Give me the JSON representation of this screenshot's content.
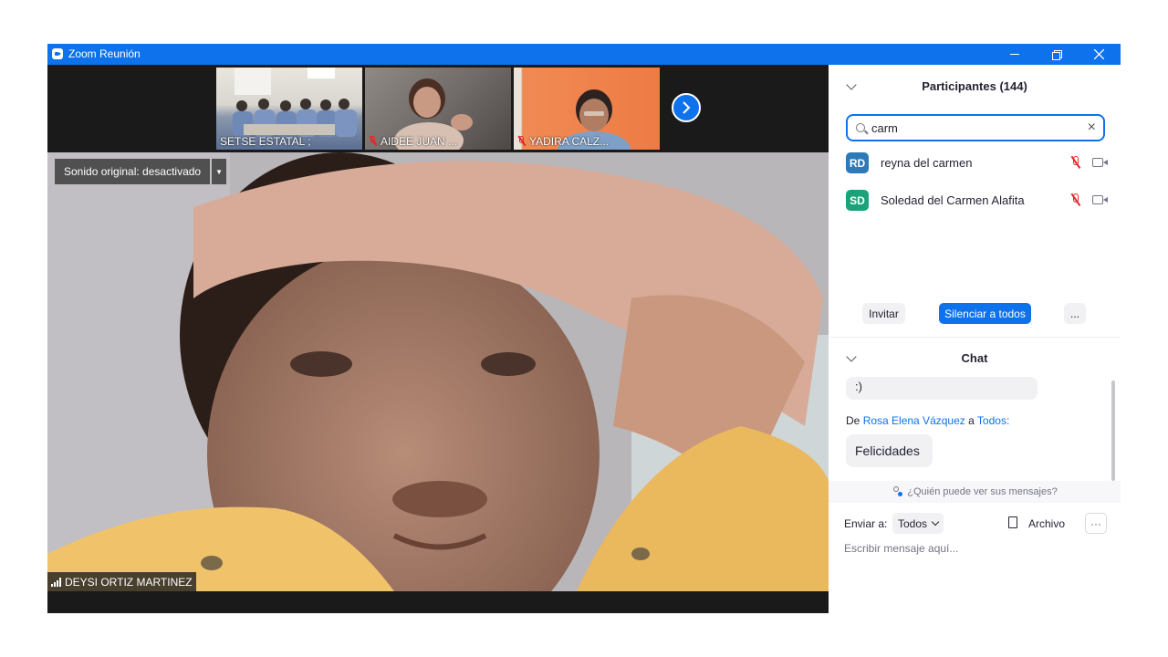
{
  "window": {
    "title": "Zoom Reunión",
    "minimize_icon": "minimize-icon",
    "restore_icon": "restore-icon",
    "close_icon": "close-icon"
  },
  "gallery": {
    "thumbnails": [
      {
        "label": "SETSE ESTATAL ;",
        "muted": false
      },
      {
        "label": "AIDEE JUAN ...",
        "muted": true
      },
      {
        "label": "YADIRA CALZ...",
        "muted": true
      }
    ],
    "next_icon": "chevron-right-icon"
  },
  "main_video": {
    "audio_setting": "Sonido original: desactivado",
    "speaker_name": "DEYSI ORTIZ MARTINEZ"
  },
  "participants": {
    "title": "Participantes (144)",
    "search_value": "carm",
    "results": [
      {
        "initials": "RD",
        "name": "reyna del carmen",
        "avatar_color": "#2e7ab8"
      },
      {
        "initials": "SD",
        "name": "Soledad del Carmen Alafita",
        "avatar_color": "#1aa37a"
      }
    ],
    "buttons": {
      "invite": "Invitar",
      "mute_all": "Silenciar a todos",
      "more": "..."
    }
  },
  "chat": {
    "title": "Chat",
    "messages": [
      {
        "text": ":)"
      },
      {
        "from_prefix": "De",
        "from": "Rosa Elena Vázquez",
        "to_word": "a",
        "to": "Todos:",
        "text": "Felicidades"
      }
    ],
    "privacy": "¿Quién puede ver sus mensajes?",
    "send_to_label": "Enviar a:",
    "send_to_value": "Todos",
    "file_label": "Archivo",
    "more": "···",
    "input_placeholder": "Escribir mensaje aquí..."
  },
  "colors": {
    "accent": "#0e72ed",
    "muted_red": "#e02828",
    "video_bg": "#1a1a1a"
  }
}
